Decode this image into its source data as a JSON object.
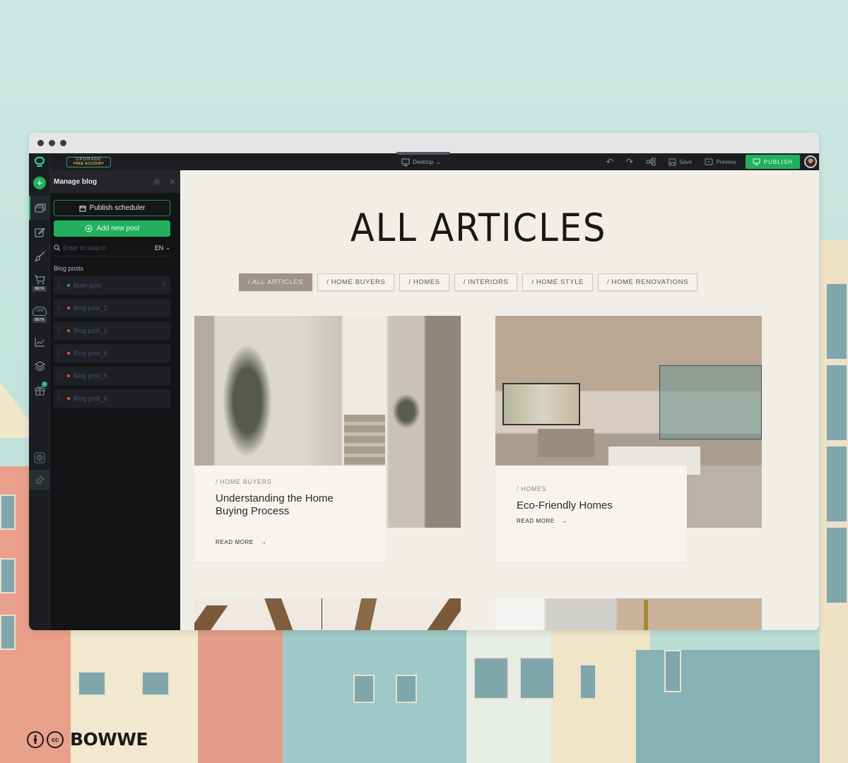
{
  "topbar": {
    "upgrade_line1": "UPGRADE",
    "upgrade_line2": "FREE ACCOUNT",
    "device": "Desktop",
    "save": "Save",
    "preview": "Preview",
    "publish": "PUBLISH"
  },
  "rail": {
    "items": [
      {
        "icon": "add-icon"
      },
      {
        "icon": "blog-icon",
        "active": true
      },
      {
        "icon": "edit-icon"
      },
      {
        "icon": "brush-icon"
      },
      {
        "icon": "cart-icon",
        "badge": "BETA"
      },
      {
        "icon": "crm-cloud-icon",
        "badge": "BETA"
      },
      {
        "icon": "analytics-icon"
      },
      {
        "icon": "layers-icon"
      },
      {
        "icon": "gift-icon",
        "notification": "1"
      },
      {
        "icon": "help-icon"
      },
      {
        "icon": "pin-icon"
      }
    ],
    "beta_label": "BETA",
    "crm_label": "CRM",
    "gift_count": "1"
  },
  "panel": {
    "title": "Manage blog",
    "publish_scheduler": "Publish scheduler",
    "add_new_post": "Add new post",
    "search_placeholder": "Enter to search",
    "language": "EN",
    "section_label": "Blog posts",
    "posts": [
      {
        "title": "Main post",
        "status": "published",
        "status_color": "#22b05e",
        "is_home": true
      },
      {
        "title": "Blog post_2",
        "status": "draft",
        "status_color": "#e0563f"
      },
      {
        "title": "Blog post_3",
        "status": "draft",
        "status_color": "#e0563f"
      },
      {
        "title": "Blog post_4",
        "status": "draft",
        "status_color": "#e0563f"
      },
      {
        "title": "Blog post_5",
        "status": "draft",
        "status_color": "#e0563f"
      },
      {
        "title": "Blog post_6",
        "status": "draft",
        "status_color": "#e0563f"
      }
    ]
  },
  "page": {
    "title": "ALL ARTICLES",
    "filters": [
      {
        "label": "/ ALL ARTICLES",
        "active": true
      },
      {
        "label": "/ HOME BUYERS",
        "active": false
      },
      {
        "label": "/ HOMES",
        "active": false
      },
      {
        "label": "/ INTERIORS",
        "active": false
      },
      {
        "label": "/ HOME STYLE",
        "active": false
      },
      {
        "label": "/ HOME RENOVATIONS",
        "active": false
      }
    ],
    "articles": [
      {
        "category": "/ HOME BUYERS",
        "title": "Understanding the Home Buying Process",
        "read_more": "READ MORE"
      },
      {
        "category": "/ HOMES",
        "title": "Eco-Friendly Homes",
        "read_more": "READ MORE"
      }
    ]
  },
  "brand": {
    "name": "BOWWE",
    "license": "cc"
  }
}
